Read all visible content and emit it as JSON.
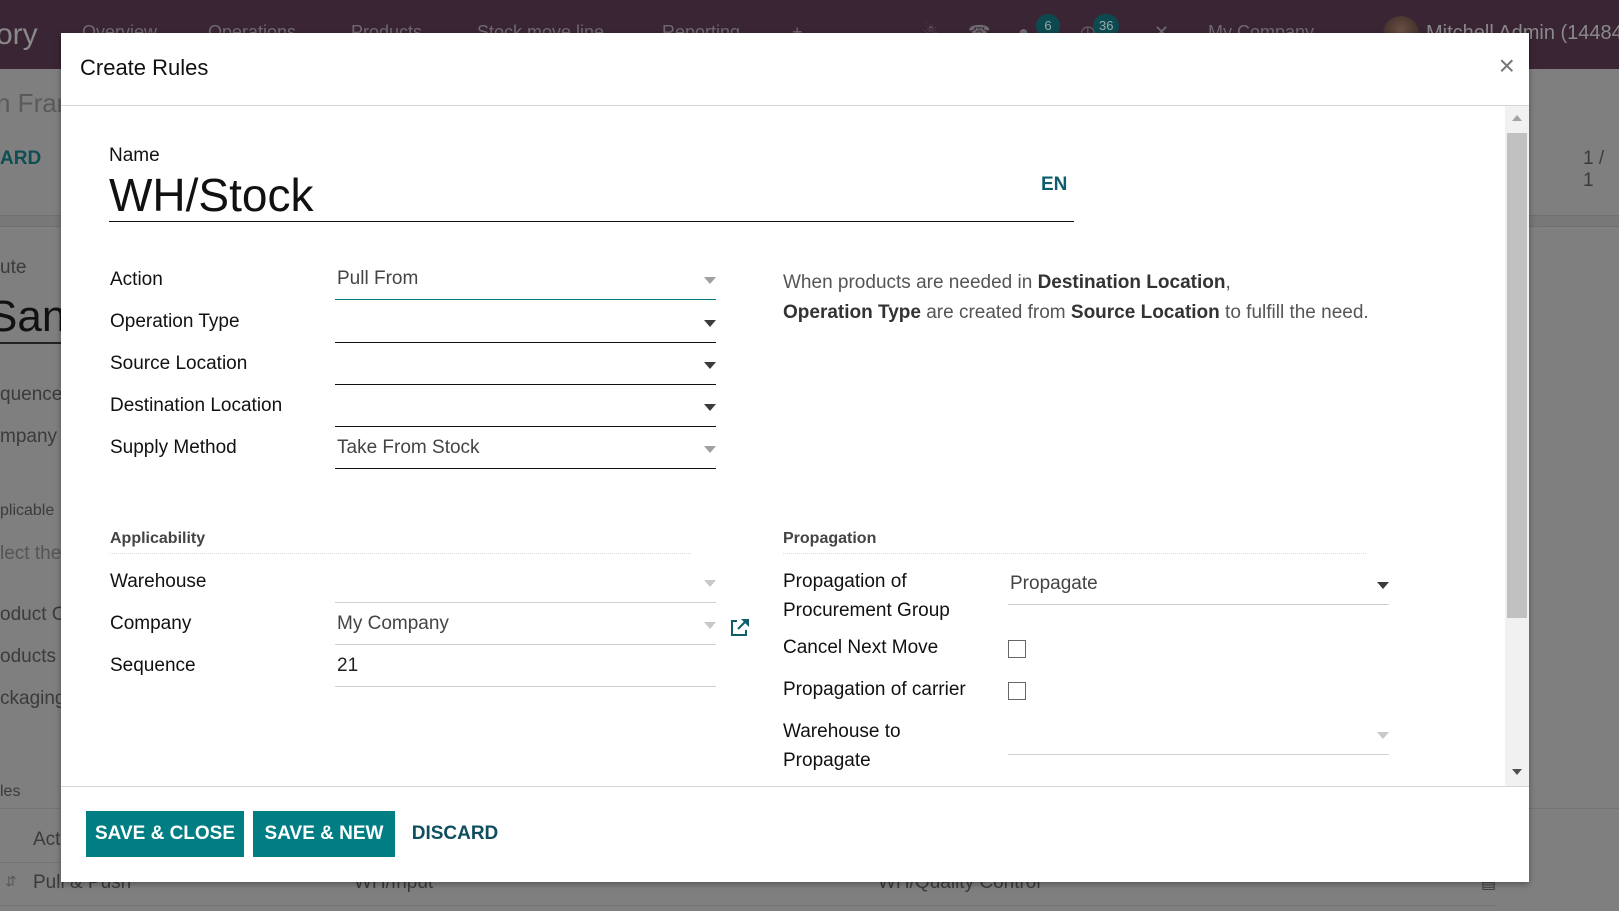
{
  "background": {
    "brand": "ory",
    "nav_items": [
      "Overview",
      "Operations",
      "Products",
      "Stock move line",
      "Reporting"
    ],
    "nav_badges": {
      "messages": "6",
      "activities": "36"
    },
    "company_switcher": "My Company",
    "user": "Mitchell Admin (14484",
    "breadcrumb_fragment": "n Fran",
    "action_button_fragment": "ARD",
    "pager": "1 / 1",
    "form_label_fragment": "ute",
    "form_title_fragment": "San",
    "side_labels": [
      "quence",
      "mpany",
      "plicable",
      "lect the",
      "oduct C",
      "oducts",
      "ckaging",
      "les"
    ],
    "table_header_fragment": "Act",
    "table_row": {
      "action": "Pull & Push",
      "source": "WH/Input",
      "destination": "WH/Quality Control"
    }
  },
  "modal": {
    "title": "Create Rules",
    "close_label": "×",
    "name": {
      "label": "Name",
      "value": "WH/Stock",
      "lang": "EN"
    },
    "fields": {
      "action": {
        "label": "Action",
        "value": "Pull From"
      },
      "operation_type": {
        "label": "Operation Type",
        "value": ""
      },
      "source_location": {
        "label": "Source Location",
        "value": ""
      },
      "destination_location": {
        "label": "Destination Location",
        "value": ""
      },
      "supply_method": {
        "label": "Supply Method",
        "value": "Take From Stock"
      }
    },
    "help": {
      "line1_pre": "When products are needed in ",
      "line1_bold": "Destination Location",
      "line1_post": ",",
      "line2_bold1": "Operation Type",
      "line2_mid": " are created from ",
      "line2_bold2": "Source Location",
      "line2_post": " to fulfill the need."
    },
    "applicability": {
      "title": "Applicability",
      "warehouse": {
        "label": "Warehouse",
        "value": ""
      },
      "company": {
        "label": "Company",
        "value": "My Company"
      },
      "sequence": {
        "label": "Sequence",
        "value": "21"
      }
    },
    "propagation": {
      "title": "Propagation",
      "procurement_group": {
        "label_line1": "Propagation of",
        "label_line2": "Procurement Group",
        "value": "Propagate"
      },
      "cancel_next_move": {
        "label": "Cancel Next Move",
        "checked": false
      },
      "carrier": {
        "label": "Propagation of carrier",
        "checked": false
      },
      "warehouse_to_propagate": {
        "label_line1": "Warehouse to",
        "label_line2": "Propagate",
        "value": ""
      }
    },
    "footer": {
      "save_close": "SAVE & CLOSE",
      "save_new": "SAVE & NEW",
      "discard": "DISCARD"
    }
  },
  "colors": {
    "primary": "#017e84",
    "navbar": "#3a2534",
    "link": "#0e4e5e"
  }
}
